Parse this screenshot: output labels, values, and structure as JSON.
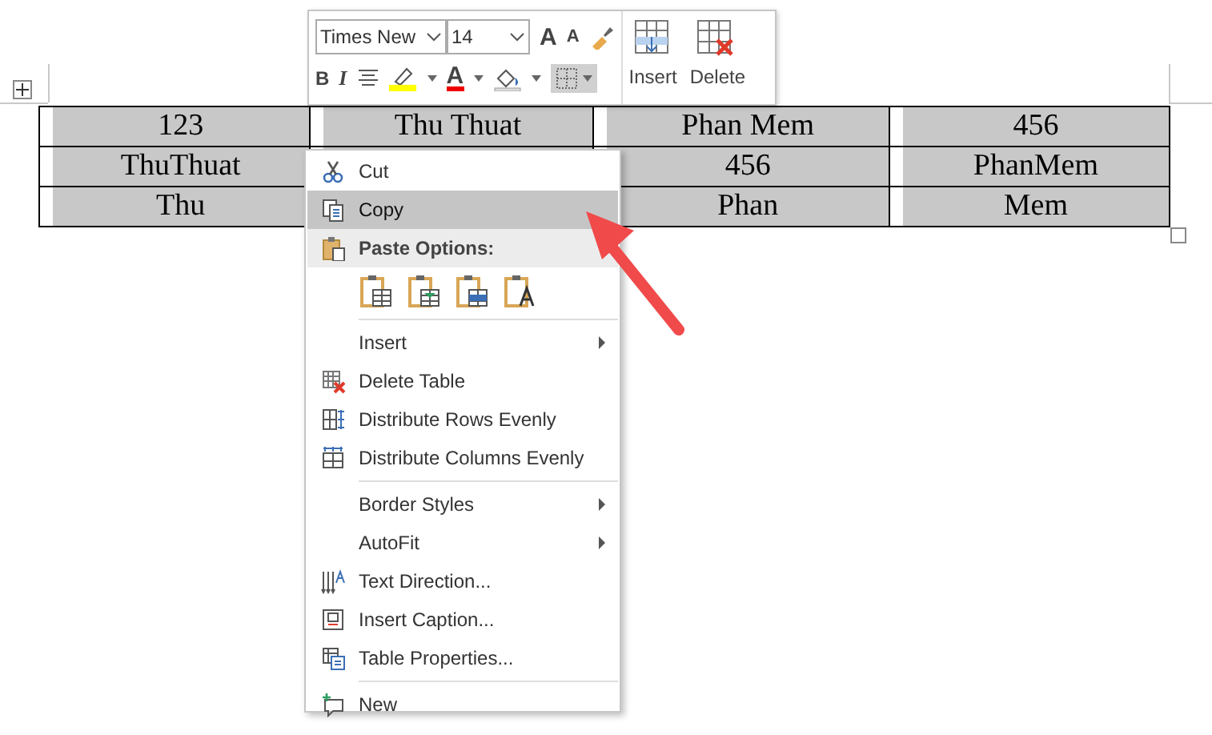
{
  "table": {
    "rows": [
      {
        "cells": [
          "123",
          "Thu Thuat",
          "Phan Mem",
          "456"
        ]
      },
      {
        "cells": [
          "ThuThuat",
          null,
          "456",
          "PhanMem"
        ]
      },
      {
        "cells": [
          "Thu",
          null,
          "Phan",
          "Mem"
        ]
      }
    ]
  },
  "mini_toolbar": {
    "font_name": "Times New",
    "font_size": "14",
    "grow_font": "A",
    "shrink_font": "A",
    "bold": "B",
    "italic": "I",
    "font_color": "A",
    "borders_selected": true,
    "insert": "Insert",
    "delete": "Delete"
  },
  "context_menu": {
    "items": [
      {
        "kind": "item",
        "label": "Cut",
        "selected": false
      },
      {
        "kind": "item",
        "label": "Copy",
        "selected": true
      },
      {
        "kind": "header",
        "label": "Paste Options:"
      },
      {
        "kind": "paste"
      },
      {
        "kind": "separator"
      },
      {
        "kind": "item",
        "label": "Insert",
        "submenu": true,
        "selected": false
      },
      {
        "kind": "item",
        "label": "Delete Table",
        "selected": false
      },
      {
        "kind": "item",
        "label": "Distribute Rows Evenly",
        "selected": false
      },
      {
        "kind": "item",
        "label": "Distribute Columns Evenly",
        "selected": false
      },
      {
        "kind": "separator"
      },
      {
        "kind": "item",
        "label": "Border Styles",
        "submenu": true,
        "selected": false
      },
      {
        "kind": "item",
        "label": "AutoFit",
        "submenu": true,
        "selected": false
      },
      {
        "kind": "item",
        "label": "Text Direction...",
        "selected": false
      },
      {
        "kind": "item",
        "label": "Insert Caption...",
        "selected": false
      },
      {
        "kind": "item",
        "label": "Table Properties...",
        "selected": false
      },
      {
        "kind": "separator"
      },
      {
        "kind": "item",
        "label": "New",
        "selected": false
      }
    ]
  }
}
